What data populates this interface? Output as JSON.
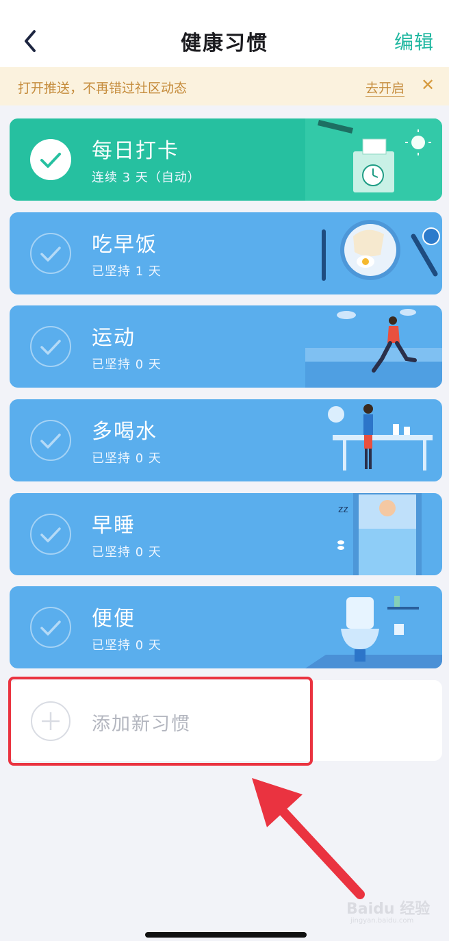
{
  "header": {
    "title": "健康习惯",
    "edit_label": "编辑"
  },
  "notice": {
    "text": "打开推送，不再错过社区动态",
    "action": "去开启",
    "close": "✕"
  },
  "habits": [
    {
      "name": "每日打卡",
      "status": "连续 3 天（自动）",
      "checked": true
    },
    {
      "name": "吃早饭",
      "status": "已坚持 1 天",
      "checked": false
    },
    {
      "name": "运动",
      "status": "已坚持 0 天",
      "checked": false
    },
    {
      "name": "多喝水",
      "status": "已坚持 0 天",
      "checked": false
    },
    {
      "name": "早睡",
      "status": "已坚持 0 天",
      "checked": false
    },
    {
      "name": "便便",
      "status": "已坚持 0 天",
      "checked": false
    }
  ],
  "add_habit": {
    "label": "添加新习惯"
  },
  "watermark": {
    "brand": "Baidu 经验",
    "url": "jingyan.baidu.com"
  },
  "colors": {
    "teal": "#26c0a0",
    "blue": "#5aaeed",
    "accent": "#1fb7a0",
    "highlight": "#ea3340"
  }
}
